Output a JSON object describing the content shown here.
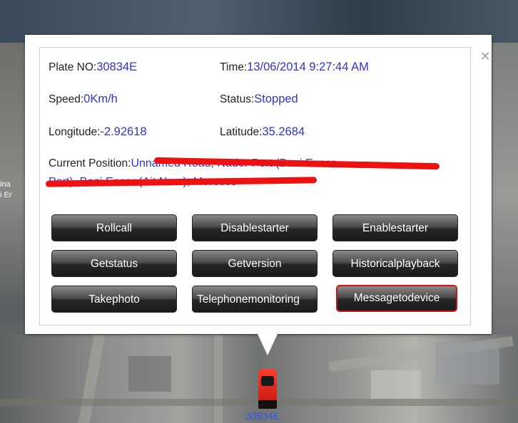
{
  "map": {
    "side_label_1": "ina",
    "side_label_2": "i Er"
  },
  "popup": {
    "close_label": "×",
    "plate": {
      "label": "Plate NO:",
      "value": "30834E"
    },
    "time": {
      "label": "Time:",
      "value": "13/06/2014 9:27:44 AM"
    },
    "speed": {
      "label": "Speed:",
      "value": "0Km/h"
    },
    "status": {
      "label": "Status:",
      "value": "Stopped"
    },
    "longitude": {
      "label": "Longitude:",
      "value": "-2.92618"
    },
    "latitude": {
      "label": "Latitude:",
      "value": "35.2684"
    },
    "position": {
      "label": "Current Position:",
      "value_line1": "Unnamed Road, Nador Port (Beni Ensar",
      "value_line2": "Port), Beni Ensar (Ait Nsar), Morocco"
    },
    "buttons": [
      {
        "label": "Rollcall"
      },
      {
        "label": "Disablestarter"
      },
      {
        "label": "Enablestarter"
      },
      {
        "label": "Getstatus"
      },
      {
        "label": "Getversion"
      },
      {
        "label": "Historicalplayback"
      },
      {
        "label": "Takephoto"
      },
      {
        "label": "Telephonemonitoring"
      },
      {
        "label": "Messagetodevice"
      }
    ]
  },
  "vehicle": {
    "label": "30834E"
  },
  "colors": {
    "value_text": "#3333cc",
    "redaction": "#ee1111",
    "active_border": "#d01414"
  }
}
